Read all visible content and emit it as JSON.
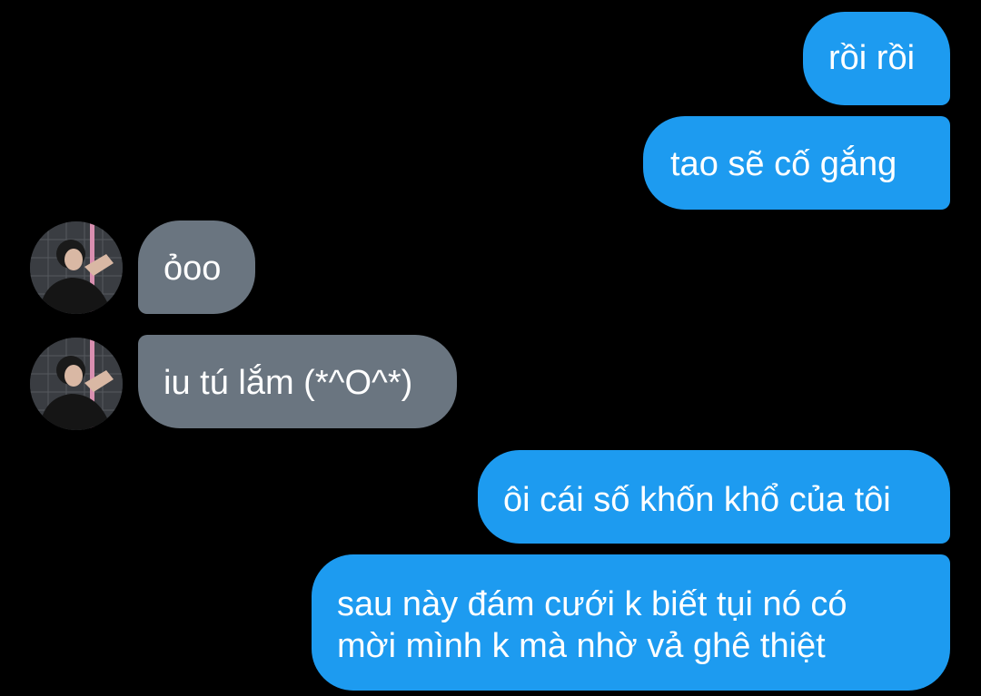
{
  "conversation": {
    "messages": [
      {
        "direction": "outgoing",
        "text": "rồi rồi"
      },
      {
        "direction": "outgoing",
        "text": "tao sẽ cố gắng"
      },
      {
        "direction": "incoming",
        "text": "ỏoo",
        "avatar": "user-avatar"
      },
      {
        "direction": "incoming",
        "text": "iu tú lắm (*^O^*)",
        "avatar": "user-avatar"
      },
      {
        "direction": "outgoing",
        "text": "ôi cái số khốn khổ của tôi"
      },
      {
        "direction": "outgoing",
        "lines": [
          "sau này đám cưới k biết tụi nó có",
          "mời mình k mà nhờ vả ghê thiệt"
        ]
      }
    ]
  },
  "colors": {
    "background": "#000000",
    "outgoing_bubble": "#1d9bf0",
    "incoming_bubble": "#6a7580",
    "text": "#ffffff"
  }
}
